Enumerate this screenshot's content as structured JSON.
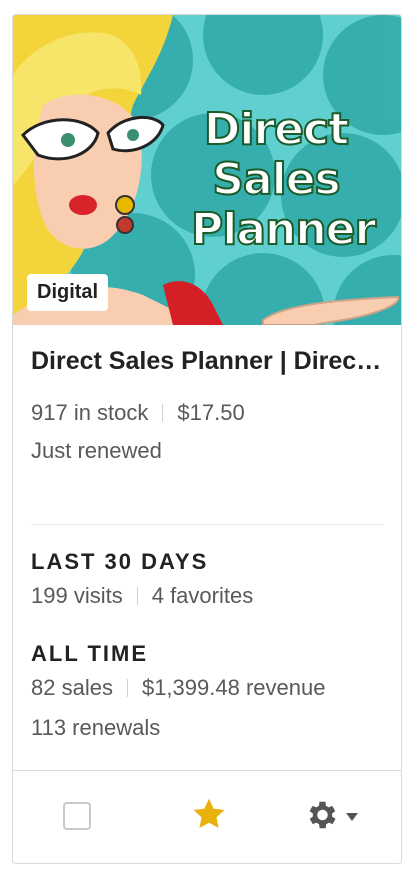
{
  "listing": {
    "image_text": [
      "Direct",
      "Sales",
      "Planner"
    ],
    "badge": "Digital",
    "title": "Direct Sales Planner | Direct Sales Planner",
    "stock": "917 in stock",
    "price": "$17.50",
    "status": "Just renewed"
  },
  "last30": {
    "heading": "LAST 30 DAYS",
    "visits": "199 visits",
    "favorites": "4 favorites"
  },
  "alltime": {
    "heading": "ALL TIME",
    "sales": "82 sales",
    "revenue": "$1,399.48 revenue",
    "renewals": "113 renewals"
  },
  "footer": {
    "star_color": "#e8b10c",
    "icons": [
      "checkbox",
      "star-icon",
      "gear-icon",
      "caret-down-icon"
    ]
  }
}
